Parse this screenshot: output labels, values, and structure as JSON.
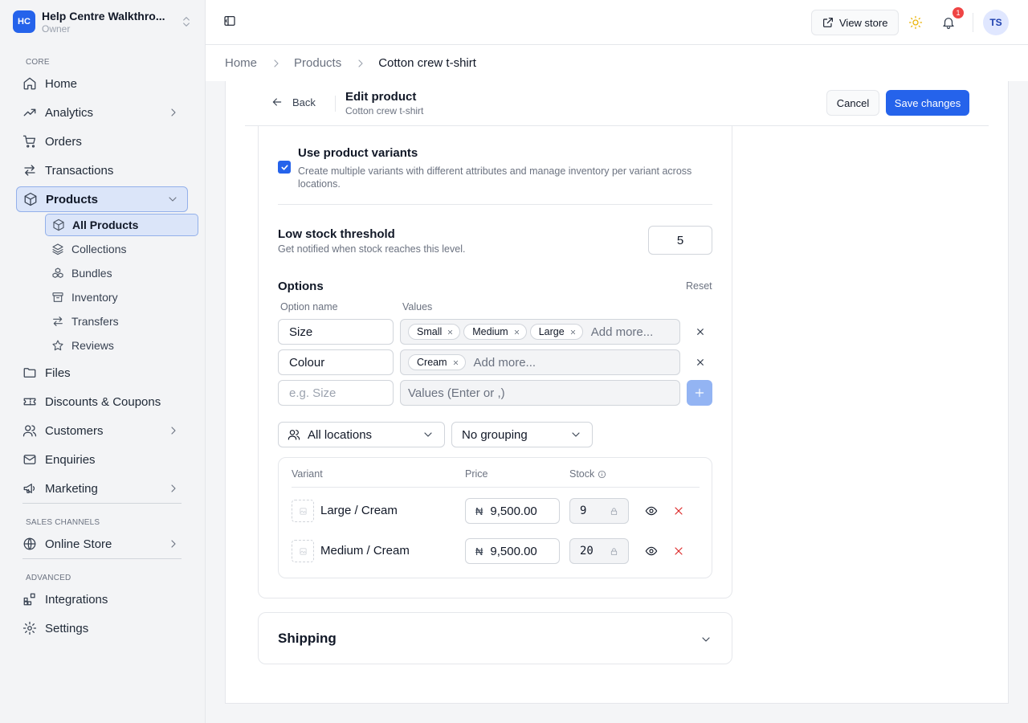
{
  "workspace": {
    "initials": "HC",
    "name": "Help Centre Walkthro...",
    "role": "Owner"
  },
  "sidebar": {
    "sections": {
      "core": "CORE",
      "sales": "SALES CHANNELS",
      "advanced": "ADVANCED"
    },
    "items": {
      "home": "Home",
      "analytics": "Analytics",
      "orders": "Orders",
      "transactions": "Transactions",
      "products": "Products",
      "files": "Files",
      "discounts": "Discounts & Coupons",
      "customers": "Customers",
      "enquiries": "Enquiries",
      "marketing": "Marketing",
      "online_store": "Online Store",
      "integrations": "Integrations",
      "settings": "Settings"
    },
    "product_sub": {
      "all": "All Products",
      "collections": "Collections",
      "bundles": "Bundles",
      "inventory": "Inventory",
      "transfers": "Transfers",
      "reviews": "Reviews"
    }
  },
  "topbar": {
    "view_store": "View store",
    "notification_count": "1",
    "avatar": "TS"
  },
  "breadcrumb": {
    "home": "Home",
    "products": "Products",
    "current": "Cotton crew t-shirt"
  },
  "editbar": {
    "back": "Back",
    "title": "Edit product",
    "subtitle": "Cotton crew t-shirt",
    "cancel": "Cancel",
    "save": "Save changes"
  },
  "variants": {
    "use_title": "Use product variants",
    "use_desc": "Create multiple variants with different attributes and manage inventory per variant across locations.",
    "checked": true
  },
  "low_stock": {
    "title": "Low stock threshold",
    "desc": "Get notified when stock reaches this level.",
    "value": "5"
  },
  "options": {
    "title": "Options",
    "reset": "Reset",
    "col_name": "Option name",
    "col_values": "Values",
    "add_more": "Add more...",
    "rows": [
      {
        "name": "Size",
        "values": [
          "Small",
          "Medium",
          "Large"
        ]
      },
      {
        "name": "Colour",
        "values": [
          "Cream"
        ]
      }
    ],
    "new_name_placeholder": "e.g. Size",
    "new_values_placeholder": "Values (Enter or ,)"
  },
  "filters": {
    "location": "All locations",
    "grouping": "No grouping"
  },
  "variant_table": {
    "headers": {
      "variant": "Variant",
      "price": "Price",
      "stock": "Stock"
    },
    "currency": "₦",
    "rows": [
      {
        "name": "Large / Cream",
        "price": "9,500.00",
        "stock": "9"
      },
      {
        "name": "Medium / Cream",
        "price": "9,500.00",
        "stock": "20"
      }
    ]
  },
  "shipping": {
    "title": "Shipping"
  },
  "colors": {
    "accent": "#2563eb",
    "danger": "#dc2626",
    "active_bg": "#dbe5f9"
  }
}
